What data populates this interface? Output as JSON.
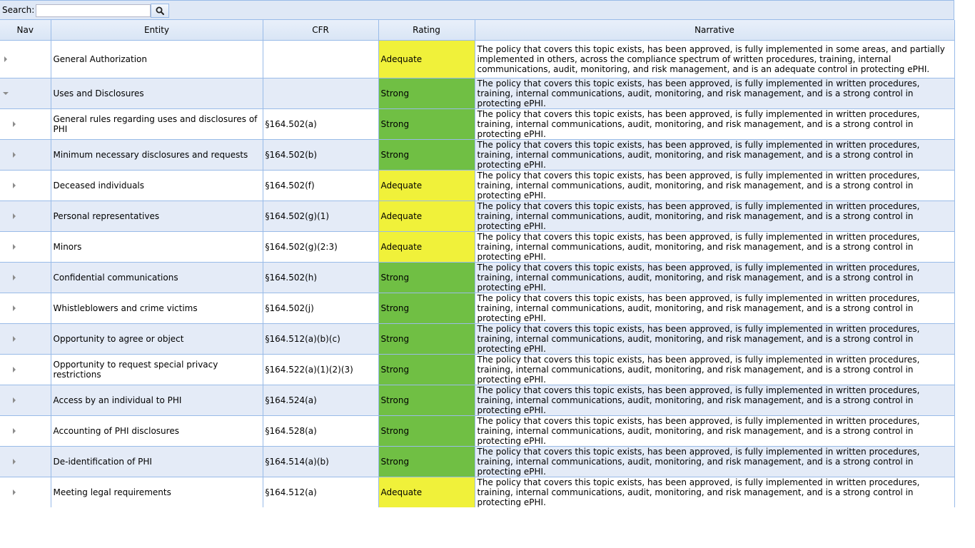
{
  "search": {
    "label": "Search:",
    "placeholder": "",
    "value": "",
    "icon": "search-icon"
  },
  "columns": {
    "nav": "Nav",
    "entity": "Entity",
    "cfr": "CFR",
    "rating": "Rating",
    "narrative": "Narrative"
  },
  "colors": {
    "strong": "#70bf44",
    "adequate": "#f0f13a",
    "border": "#99bbe8",
    "alt_row": "#e4ebf7"
  },
  "rows": [
    {
      "entity": "General Authorization",
      "cfr": "",
      "rating": "Adequate",
      "narrative": "The policy that covers this topic exists, has been approved, is fully implemented in some areas, and partially implemented in others, across the compliance spectrum of written procedures, training, internal communications, audit, monitoring, and risk management, and is an adequate control in protecting ePHI."
    },
    {
      "entity": "Uses and Disclosures",
      "cfr": "",
      "rating": "Strong",
      "narrative": "The policy that covers this topic exists, has been approved, is fully implemented in written procedures, training, internal communications, audit, monitoring, and risk management, and is a strong control in protecting ePHI."
    },
    {
      "entity": "General rules regarding uses and disclosures of PHI",
      "cfr": "§164.502(a)",
      "rating": "Strong",
      "narrative": "The policy that covers this topic exists, has been approved, is fully implemented in written procedures, training, internal communications, audit, monitoring, and risk management, and is a strong control in protecting ePHI."
    },
    {
      "entity": "Minimum necessary disclosures and requests",
      "cfr": "§164.502(b)",
      "rating": "Strong",
      "narrative": "The policy that covers this topic exists, has been approved, is fully implemented in written procedures, training, internal communications, audit, monitoring, and risk management, and is a strong control in protecting ePHI."
    },
    {
      "entity": "Deceased individuals",
      "cfr": "§164.502(f)",
      "rating": "Adequate",
      "narrative": "The policy that covers this topic exists, has been approved, is fully implemented in written procedures, training, internal communications, audit, monitoring, and risk management, and is a strong control in protecting ePHI."
    },
    {
      "entity": "Personal representatives",
      "cfr": "§164.502(g)(1)",
      "rating": "Adequate",
      "narrative": "The policy that covers this topic exists, has been approved, is fully implemented in written procedures, training, internal communications, audit, monitoring, and risk management, and is a strong control in protecting ePHI."
    },
    {
      "entity": "Minors",
      "cfr": "§164.502(g)(2:3)",
      "rating": "Adequate",
      "narrative": "The policy that covers this topic exists, has been approved, is fully implemented in written procedures, training, internal communications, audit, monitoring, and risk management, and is a strong control in protecting ePHI."
    },
    {
      "entity": "Confidential communications",
      "cfr": "§164.502(h)",
      "rating": "Strong",
      "narrative": "The policy that covers this topic exists, has been approved, is fully implemented in written procedures, training, internal communications, audit, monitoring, and risk management, and is a strong control in protecting ePHI."
    },
    {
      "entity": "Whistleblowers and crime victims",
      "cfr": "§164.502(j)",
      "rating": "Strong",
      "narrative": "The policy that covers this topic exists, has been approved, is fully implemented in written procedures, training, internal communications, audit, monitoring, and risk management, and is a strong control in protecting ePHI."
    },
    {
      "entity": "Opportunity to agree or object",
      "cfr": "§164.512(a)(b)(c)",
      "rating": "Strong",
      "narrative": "The policy that covers this topic exists, has been approved, is fully implemented in written procedures, training, internal communications, audit, monitoring, and risk management, and is a strong control in protecting ePHI."
    },
    {
      "entity": "Opportunity to request special privacy restrictions",
      "cfr": "§164.522(a)(1)(2)(3)",
      "rating": "Strong",
      "narrative": "The policy that covers this topic exists, has been approved, is fully implemented in written procedures, training, internal communications, audit, monitoring, and risk management, and is a strong control in protecting ePHI."
    },
    {
      "entity": "Access by an individual to PHI",
      "cfr": "§164.524(a)",
      "rating": "Strong",
      "narrative": "The policy that covers this topic exists, has been approved, is fully implemented in written procedures, training, internal communications, audit, monitoring, and risk management, and is a strong control in protecting ePHI."
    },
    {
      "entity": "Accounting of PHI disclosures",
      "cfr": "§164.528(a)",
      "rating": "Strong",
      "narrative": "The policy that covers this topic exists, has been approved, is fully implemented in written procedures, training, internal communications, audit, monitoring, and risk management, and is a strong control in protecting ePHI."
    },
    {
      "entity": "De-identification of PHI",
      "cfr": "§164.514(a)(b)",
      "rating": "Strong",
      "narrative": "The policy that covers this topic exists, has been approved, is fully implemented in written procedures, training, internal communications, audit, monitoring, and risk management, and is a strong control in protecting ePHI."
    },
    {
      "entity": "Meeting legal requirements",
      "cfr": "§164.512(a)",
      "rating": "Adequate",
      "narrative": "The policy that covers this topic exists, has been approved, is fully implemented in written procedures, training, internal communications, audit, monitoring, and risk management, and is a strong control in protecting ePHI."
    }
  ]
}
